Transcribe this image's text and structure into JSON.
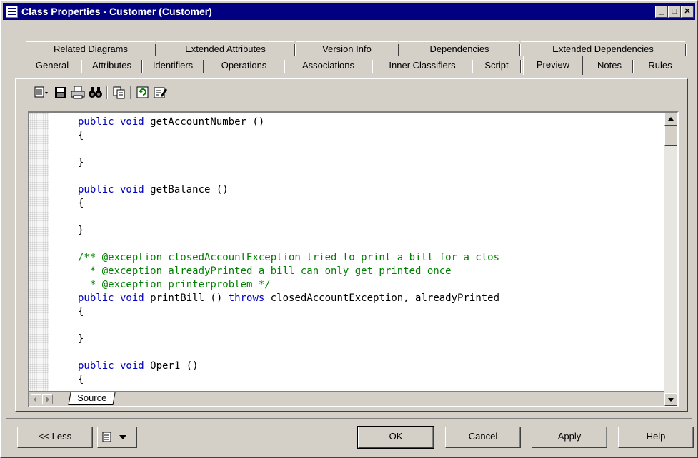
{
  "window": {
    "title": "Class Properties - Customer (Customer)"
  },
  "tabs_back": [
    "Related Diagrams",
    "Extended Attributes",
    "Version Info",
    "Dependencies",
    "Extended Dependencies"
  ],
  "tabs_front": [
    "General",
    "Attributes",
    "Identifiers",
    "Operations",
    "Associations",
    "Inner Classifiers",
    "Script",
    "Preview",
    "Notes",
    "Rules"
  ],
  "active_tab": "Preview",
  "toolbar": {
    "icons": [
      "list-menu-icon",
      "save-icon",
      "print-icon",
      "find-icon",
      "copy-icon",
      "refresh-icon",
      "edit-icon"
    ]
  },
  "code_lines": [
    [
      [
        "kw",
        "public void"
      ],
      [
        "t",
        " getAccountNumber ()"
      ]
    ],
    [
      [
        "t",
        "{"
      ]
    ],
    [
      [
        "t",
        ""
      ]
    ],
    [
      [
        "t",
        "}"
      ]
    ],
    [
      [
        "t",
        ""
      ]
    ],
    [
      [
        "kw",
        "public void"
      ],
      [
        "t",
        " getBalance ()"
      ]
    ],
    [
      [
        "t",
        "{"
      ]
    ],
    [
      [
        "t",
        ""
      ]
    ],
    [
      [
        "t",
        "}"
      ]
    ],
    [
      [
        "t",
        ""
      ]
    ],
    [
      [
        "cm",
        "/** @exception closedAccountException tried to print a bill for a clos"
      ]
    ],
    [
      [
        "cm",
        "  * @exception alreadyPrinted a bill can only get printed once"
      ]
    ],
    [
      [
        "cm",
        "  * @exception printerproblem */"
      ]
    ],
    [
      [
        "kw",
        "public void"
      ],
      [
        "t",
        " printBill () "
      ],
      [
        "kw",
        "throws"
      ],
      [
        "t",
        " closedAccountException, alreadyPrinted"
      ]
    ],
    [
      [
        "t",
        "{"
      ]
    ],
    [
      [
        "t",
        ""
      ]
    ],
    [
      [
        "t",
        "}"
      ]
    ],
    [
      [
        "t",
        ""
      ]
    ],
    [
      [
        "kw",
        "public void"
      ],
      [
        "t",
        " Oper1 ()"
      ]
    ],
    [
      [
        "t",
        "{"
      ]
    ]
  ],
  "source_tab": "Source",
  "buttons": {
    "less": "<< Less",
    "ok": "OK",
    "cancel": "Cancel",
    "apply": "Apply",
    "help": "Help"
  },
  "colors": {
    "keyword": "#0000c0",
    "comment": "#008000",
    "titlebar": "#000080"
  }
}
